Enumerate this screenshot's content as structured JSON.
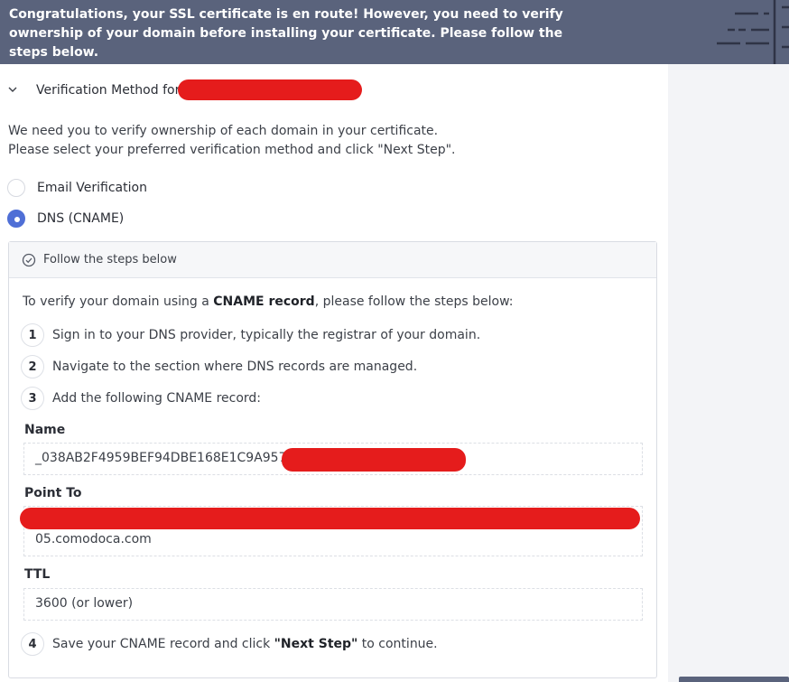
{
  "banner": {
    "text": "Congratulations, your SSL certificate is en route! However, you need to verify ownership of your domain before installing your certificate. Please follow the steps below."
  },
  "section": {
    "title": "Verification Method for"
  },
  "intro": {
    "line1": "We need you to verify ownership of each domain in your certificate.",
    "line2": "Please select your preferred verification method and click \"Next Step\"."
  },
  "methods": [
    {
      "label": "Email Verification",
      "selected": false
    },
    {
      "label": "DNS (CNAME)",
      "selected": true
    }
  ],
  "panel": {
    "header": "Follow the steps below",
    "lead_prefix": "To verify your domain using a ",
    "lead_bold": "CNAME record",
    "lead_suffix": ", please follow the steps below:",
    "steps": [
      {
        "num": "1",
        "text": "Sign in to your DNS provider, typically the registrar of your domain."
      },
      {
        "num": "2",
        "text": "Navigate to the section where DNS records are managed."
      },
      {
        "num": "3",
        "text": "Add the following CNAME record:"
      },
      {
        "num": "4",
        "text_prefix": "Save your CNAME record and click ",
        "text_bold": "\"Next Step\"",
        "text_suffix": " to continue."
      }
    ],
    "fields": {
      "name_label": "Name",
      "name_value": "_038AB2F4959BEF94DBE168E1C9A95716",
      "point_label": "Point To",
      "point_value": "05.comodoca.com",
      "ttl_label": "TTL",
      "ttl_value": "3600 (or lower)"
    }
  },
  "colors": {
    "banner": "#5a637c",
    "accent": "#4f6fd6",
    "redaction": "#e51c1c"
  }
}
